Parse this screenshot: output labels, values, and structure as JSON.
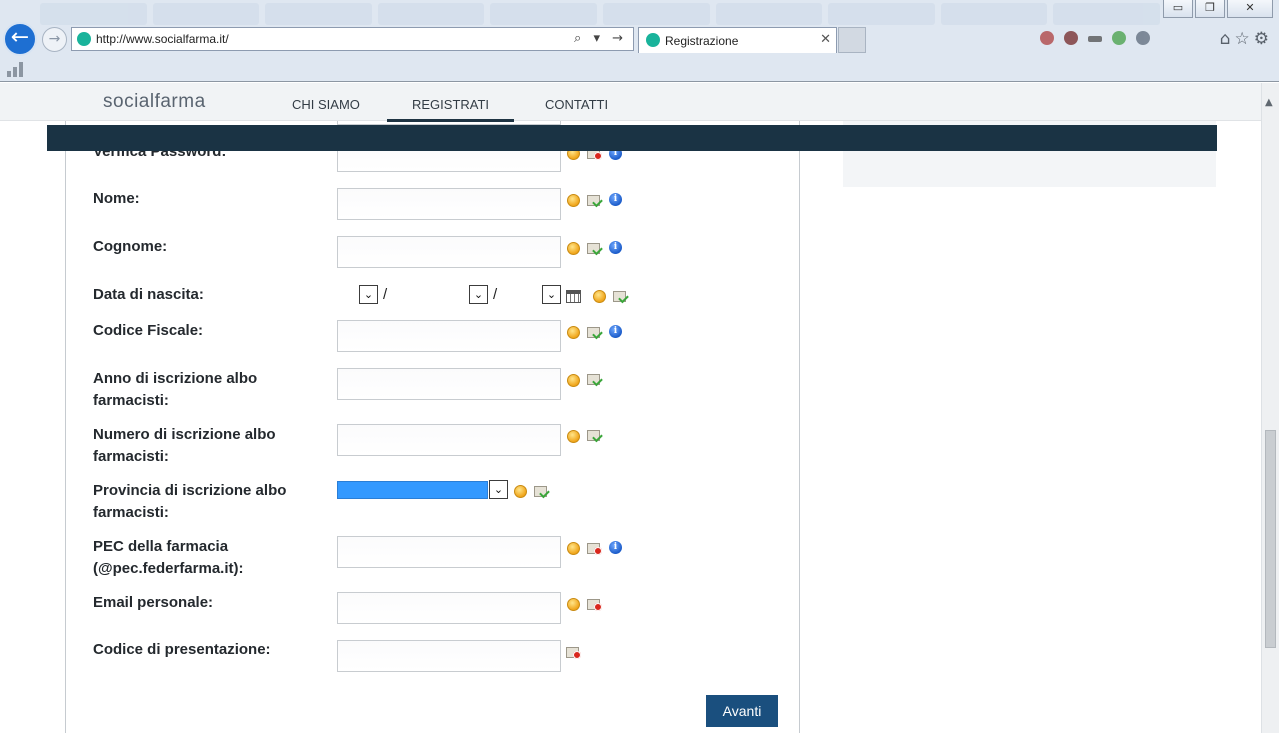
{
  "browser": {
    "url": "http://www.socialfarma.it/",
    "tab_title": "Registrazione",
    "minimize": "▭",
    "restore": "❐",
    "close": "✕",
    "back": "←",
    "forward": "→",
    "address_icons": "⌕ ▾ →",
    "tab_close": "✕",
    "right_icons": "⌂☆⚙"
  },
  "nav": {
    "logo": "socialfarma",
    "items": [
      "CHI SIAMO",
      "REGISTRATI",
      "CONTATTI"
    ],
    "active_item": "REGISTRATI"
  },
  "form": {
    "fields": [
      {
        "label": "Verifica Password:",
        "icons": [
          "warn-icon",
          "invalid-icon",
          "info-icon"
        ]
      },
      {
        "label": "Nome:",
        "value": "",
        "icons": [
          "warn-icon",
          "valid-icon",
          "info-icon"
        ]
      },
      {
        "label": "Cognome:",
        "value": "",
        "icons": [
          "warn-icon",
          "valid-icon",
          "info-icon"
        ]
      },
      {
        "label": "Data di nascita:",
        "separator": "/",
        "icons": [
          "calendar-icon",
          "warn-icon",
          "valid-icon"
        ]
      },
      {
        "label": "Codice Fiscale:",
        "value": "",
        "icons": [
          "warn-icon",
          "valid-icon",
          "info-icon"
        ]
      },
      {
        "label": "Anno di iscrizione albo farmacisti:",
        "value": "",
        "icons": [
          "warn-icon",
          "valid-icon"
        ]
      },
      {
        "label": "Numero di iscrizione albo farmacisti:",
        "value": "",
        "icons": [
          "warn-icon",
          "valid-icon"
        ]
      },
      {
        "label": "Provincia di iscrizione albo farmacisti:",
        "value": "",
        "icons": [
          "warn-icon",
          "valid-icon"
        ]
      },
      {
        "label": "PEC della farmacia (@pec.federfarma.it):",
        "value": "",
        "icons": [
          "warn-icon",
          "invalid-icon",
          "info-icon"
        ]
      },
      {
        "label": "Email personale:",
        "value": "",
        "icons": [
          "warn-icon",
          "invalid-icon"
        ]
      },
      {
        "label": "Codice di presentazione:",
        "value": "",
        "icons": [
          "invalid-icon"
        ]
      }
    ],
    "info_glyph": "i",
    "dropdown_glyph": "⌄",
    "submit_label": "Avanti"
  },
  "colors": {
    "dark_band": "#1a3344",
    "button": "#1a4f7e",
    "selected_option": "#3399ff"
  }
}
